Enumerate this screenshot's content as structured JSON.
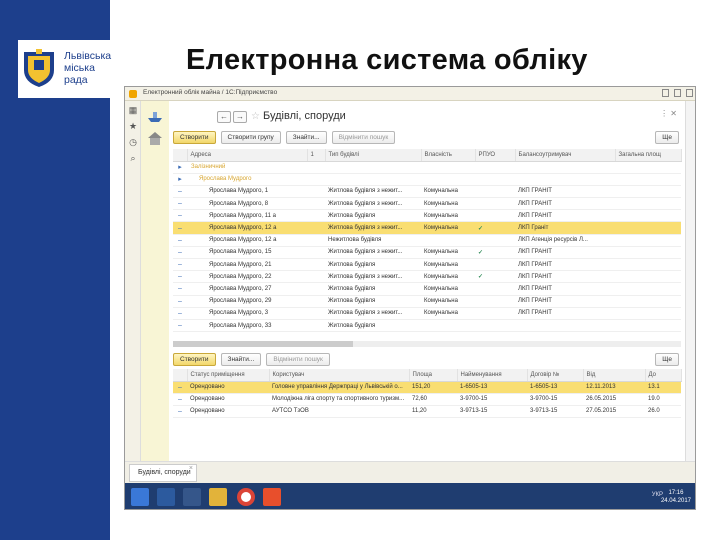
{
  "slide": {
    "title": "Електронна система обліку",
    "logo_lines": [
      "Львівська",
      "міська",
      "рада"
    ]
  },
  "window": {
    "title": "Електронний облік майна / 1С:Підприємство",
    "form_title": "Будівлі, споруди"
  },
  "toolbar1": [
    "Створити",
    "Створити групу",
    "Знайти...",
    "Відмінити пошук"
  ],
  "more_label": "Ще",
  "buildings_table": {
    "columns": [
      "Адреса",
      "1",
      "Тип будівлі",
      "Власність",
      "РПУО",
      "Балансоутримувач",
      "Загальна площ"
    ],
    "rows": [
      {
        "type": "folder",
        "address": "Залізничний",
        "num": "",
        "kind": "",
        "ownership": "",
        "rpuo": "",
        "holder": "",
        "area": "",
        "selected": false
      },
      {
        "type": "folder",
        "address": "Ярослава Мудрого",
        "num": "",
        "kind": "",
        "ownership": "",
        "rpuo": "",
        "holder": "",
        "area": "",
        "selected": false
      },
      {
        "type": "item",
        "address": "Ярослава Мудрого, 1",
        "num": "",
        "kind": "Житлова будівля з нежит...",
        "ownership": "Комунальна",
        "rpuo": "",
        "holder": "ЛКП ГРАНІТ",
        "area": "",
        "selected": false
      },
      {
        "type": "item",
        "address": "Ярослава Мудрого, 8",
        "num": "",
        "kind": "Житлова будівля з нежит...",
        "ownership": "Комунальна",
        "rpuo": "",
        "holder": "ЛКП ГРАНІТ",
        "area": "",
        "selected": false
      },
      {
        "type": "item",
        "address": "Ярослава Мудрого, 11 а",
        "num": "",
        "kind": "Житлова будівля",
        "ownership": "Комунальна",
        "rpuo": "",
        "holder": "ЛКП ГРАНІТ",
        "area": "",
        "selected": false
      },
      {
        "type": "item",
        "address": "Ярослава Мудрого, 12 а",
        "num": "",
        "kind": "Житлова будівля з нежит...",
        "ownership": "Комунальна",
        "rpuo": "✓",
        "holder": "ЛКП Граніт",
        "area": "",
        "selected": true
      },
      {
        "type": "item",
        "address": "Ярослава Мудрого, 12 а",
        "num": "",
        "kind": "Нежитлова будівля",
        "ownership": "",
        "rpuo": "",
        "holder": "ЛКП Агенція ресурсів Л...",
        "area": "",
        "selected": false
      },
      {
        "type": "item",
        "address": "Ярослава Мудрого, 15",
        "num": "",
        "kind": "Житлова будівля з нежит...",
        "ownership": "Комунальна",
        "rpuo": "✓",
        "holder": "ЛКП ГРАНІТ",
        "area": "",
        "selected": false
      },
      {
        "type": "item",
        "address": "Ярослава Мудрого, 21",
        "num": "",
        "kind": "Житлова будівля",
        "ownership": "Комунальна",
        "rpuo": "",
        "holder": "ЛКП ГРАНІТ",
        "area": "",
        "selected": false
      },
      {
        "type": "item",
        "address": "Ярослава Мудрого, 22",
        "num": "",
        "kind": "Житлова будівля з нежит...",
        "ownership": "Комунальна",
        "rpuo": "✓",
        "holder": "ЛКП ГРАНІТ",
        "area": "",
        "selected": false
      },
      {
        "type": "item",
        "address": "Ярослава Мудрого, 27",
        "num": "",
        "kind": "Житлова будівля",
        "ownership": "Комунальна",
        "rpuo": "",
        "holder": "ЛКП ГРАНІТ",
        "area": "",
        "selected": false
      },
      {
        "type": "item",
        "address": "Ярослава Мудрого, 29",
        "num": "",
        "kind": "Житлова будівля",
        "ownership": "Комунальна",
        "rpuo": "",
        "holder": "ЛКП ГРАНІТ",
        "area": "",
        "selected": false
      },
      {
        "type": "item",
        "address": "Ярослава Мудрого, 3",
        "num": "",
        "kind": "Житлова будівля з нежит...",
        "ownership": "Комунальна",
        "rpuo": "",
        "holder": "ЛКП ГРАНІТ",
        "area": "",
        "selected": false
      },
      {
        "type": "item",
        "address": "Ярослава Мудрого, 33",
        "num": "",
        "kind": "Житлова будівля",
        "ownership": "",
        "rpuo": "",
        "holder": "",
        "area": "",
        "selected": false
      }
    ]
  },
  "toolbar2": [
    "Створити",
    "Знайти...",
    "Відмінити пошук"
  ],
  "premises_table": {
    "columns": [
      "",
      "Статус приміщення",
      "Користувач",
      "Площа",
      "Найменування",
      "Договір №",
      "Від",
      "До"
    ],
    "rows": [
      {
        "status": "Орендовано",
        "user": "Головне управління Держпраці у Львівській о...",
        "area": "151,20",
        "name": "1-6505-13",
        "contract": "1-6505-13",
        "from": "12.11.2013",
        "to": "13.1",
        "selected": true
      },
      {
        "status": "Орендовано",
        "user": "Молодіжна ліга спорту та спортивного туризм...",
        "area": "72,60",
        "name": "3-9700-15",
        "contract": "3-9700-15",
        "from": "26.05.2015",
        "to": "19.0",
        "selected": false
      },
      {
        "status": "Орендовано",
        "user": "АУТСО ТзОВ",
        "area": "11,20",
        "name": "3-9713-15",
        "contract": "3-9713-15",
        "from": "27.05.2015",
        "to": "26.0",
        "selected": false
      }
    ]
  },
  "tab_label": "Будівлі, споруди",
  "taskbar": {
    "lang": "УКР",
    "time": "17:16",
    "date": "24.04.2017"
  }
}
